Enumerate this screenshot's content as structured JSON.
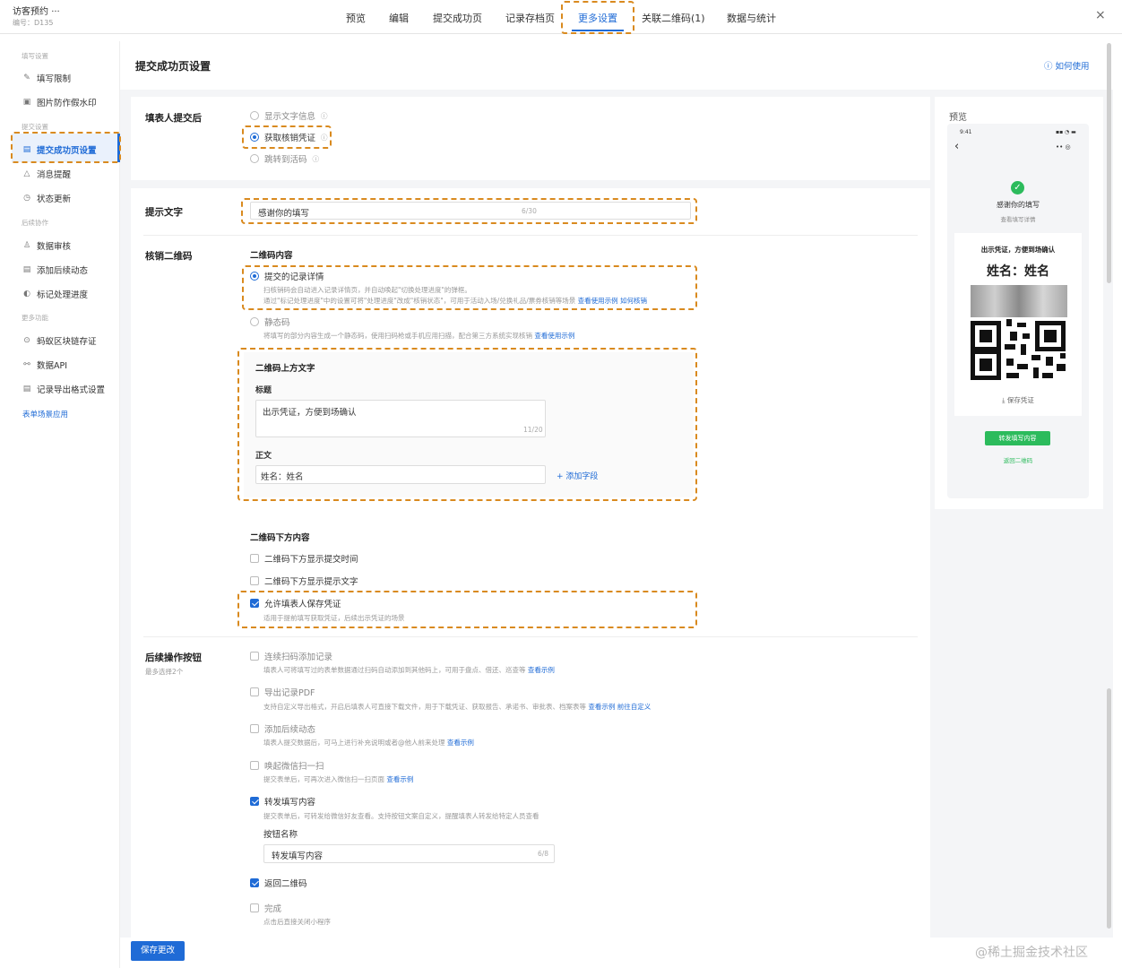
{
  "app": {
    "title": "访客预约",
    "more": "···",
    "sub": "编号：D135"
  },
  "tabs": [
    "预览",
    "编辑",
    "提交成功页",
    "记录存档页",
    "更多设置",
    "关联二维码(1)",
    "数据与统计"
  ],
  "close": "×",
  "sidebar": {
    "g1": "填写设置",
    "i1": "填写限制",
    "i2": "图片防作假水印",
    "g2": "提交设置",
    "i3": "提交成功页设置",
    "i4": "消息提醒",
    "i5": "状态更新",
    "g3": "后续协作",
    "i6": "数据审核",
    "i7": "添加后续动态",
    "i8": "标记处理进度",
    "g4": "更多功能",
    "i9": "蚂蚁区块链存证",
    "i10": "数据API",
    "i11": "记录导出格式设置",
    "link": "表单场景应用"
  },
  "page": {
    "title": "提交成功页设置",
    "help": "如何使用"
  },
  "after": {
    "label": "填表人提交后",
    "o1": "显示文字信息",
    "o2": "获取核销凭证",
    "o3": "跳转到活码"
  },
  "tip": {
    "label": "提示文字",
    "value": "感谢你的填写",
    "count": "6/30"
  },
  "qr": {
    "label": "核销二维码",
    "content_h": "二维码内容",
    "opt1": "提交的记录详情",
    "opt1_d1": "扫核销码会自动进入记录详情页，并自动唤起\"切换处理进度\"的弹框。",
    "opt1_d2": "通过\"标记处理进度\"中的设置可将\"处理进度\"改成\"核销状态\"，可用于活动入场/兑换礼品/票券核销等场景",
    "opt1_l1": "查看使用示例",
    "opt1_l2": "如何核销",
    "opt2": "静态码",
    "opt2_d": "将填写的部分内容生成一个静态码，使用扫码枪或手机应用扫描，配合第三方系统实现核销",
    "opt2_l": "查看使用示例",
    "above_h": "二维码上方文字",
    "title_l": "标题",
    "title_v": "出示凭证，方便到场确认",
    "title_c": "11/20",
    "body_l": "正文",
    "body_v": "姓名：姓名",
    "add_field": "+ 添加字段",
    "below_h": "二维码下方内容",
    "b1": "二维码下方显示提交时间",
    "b2": "二维码下方显示提示文字",
    "b3": "允许填表人保存凭证",
    "b3_d": "适用于提前填写获取凭证，后续出示凭证的场景"
  },
  "follow": {
    "label": "后续操作按钮",
    "sub": "最多选择2个",
    "f1": "连续扫码添加记录",
    "f1_d": "填表人可将填写过的表单数据通过扫码自动添加到其他码上，可用于盘点、借还、巡查等",
    "f1_l": "查看示例",
    "f2": "导出记录PDF",
    "f2_d": "支持自定义导出格式，开启后填表人可直接下载文件，用于下载凭证、获取报告、承诺书、审批表、档案表等",
    "f2_l": "查看示例",
    "f2_l2": "前往自定义",
    "f3": "添加后续动态",
    "f3_d": "填表人提交数据后，可马上进行补充说明或者@他人前来处理",
    "f3_l": "查看示例",
    "f4": "唤起微信扫一扫",
    "f4_d": "提交表单后，可再次进入微信扫一扫页面",
    "f4_l": "查看示例",
    "f5": "转发填写内容",
    "f5_d": "提交表单后，可转发给微信好友查看。支持按钮文案自定义，提醒填表人转发给特定人员查看",
    "btn_l": "按钮名称",
    "btn_v": "转发填写内容",
    "btn_c": "6/8",
    "f6": "返回二维码",
    "f7": "完成",
    "f7_d": "点击后直接关闭小程序"
  },
  "save": "保存更改",
  "preview": {
    "label": "预览",
    "time": "9:41",
    "status": "▪▪ ◔ ▬",
    "back": "‹",
    "menu": "•• ◎",
    "thanks": "感谢你的填写",
    "view": "查看填写详情",
    "ctitle": "出示凭证，方便到场确认",
    "name": "姓名：姓名",
    "savev": "⤓ 保存凭证",
    "fwd": "转发填写内容",
    "retqr": "返回二维码"
  },
  "watermark": "@稀土掘金技术社区"
}
